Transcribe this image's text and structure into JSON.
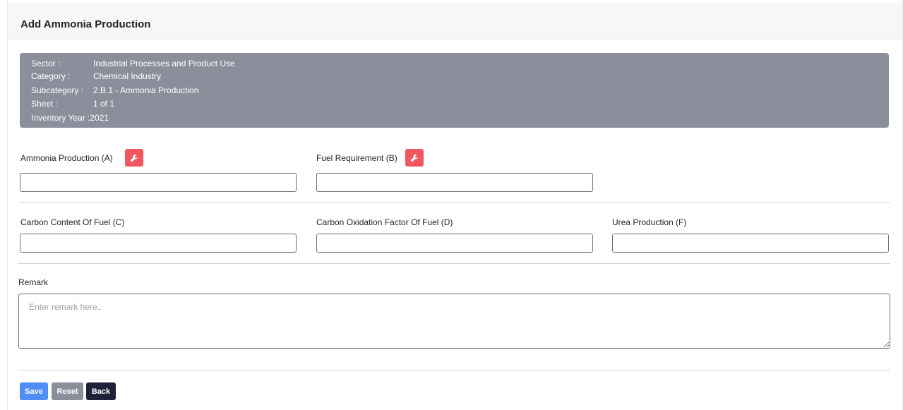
{
  "header": {
    "title": "Add Ammonia Production"
  },
  "info": {
    "sector_label": "Sector :",
    "sector_value": "Industrial Processes and Product Use",
    "category_label": "Category :",
    "category_value": "Chemical Industry",
    "subcategory_label": "Subcategory :",
    "subcategory_value": "2.B.1 - Ammonia Production",
    "sheet_label": "Sheet :",
    "sheet_value": "1 of 1",
    "year_label": "Inventory Year :",
    "year_value": "2021"
  },
  "fields": {
    "ammonia_production": {
      "label": "Ammonia Production (A)",
      "value": ""
    },
    "fuel_requirement": {
      "label": "Fuel Requirement (B)",
      "value": ""
    },
    "carbon_content": {
      "label": "Carbon Content Of Fuel (C)",
      "value": ""
    },
    "carbon_oxidation": {
      "label": "Carbon Oxidation Factor Of Fuel (D)",
      "value": ""
    },
    "urea_production": {
      "label": "Urea Production (F)",
      "value": ""
    }
  },
  "remark": {
    "label": "Remark",
    "placeholder": "Enter remark here..",
    "value": ""
  },
  "buttons": {
    "save": "Save",
    "reset": "Reset",
    "back": "Back"
  },
  "colors": {
    "info_bg": "#8a8f9b",
    "tool_button": "#f2575f",
    "save": "#4f8ef7",
    "reset": "#8a8f9b",
    "back": "#1d2238"
  },
  "icons": {
    "tool_button": "wrench-icon",
    "resize": "resize-handle-icon"
  }
}
